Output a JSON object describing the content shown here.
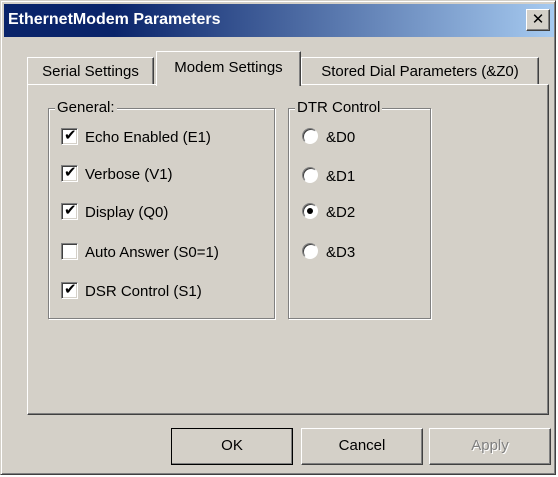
{
  "window": {
    "title": "EthernetModem Parameters",
    "close_glyph": "✕"
  },
  "tabs": [
    {
      "label": "Serial Settings",
      "active": false
    },
    {
      "label": "Modem Settings",
      "active": true
    },
    {
      "label": "Stored Dial Parameters (&Z0)",
      "active": false
    }
  ],
  "general": {
    "title": "General:",
    "options": [
      {
        "label": "Echo Enabled (E1)",
        "checked": true
      },
      {
        "label": "Verbose (V1)",
        "checked": true
      },
      {
        "label": "Display (Q0)",
        "checked": true
      },
      {
        "label": "Auto Answer (S0=1)",
        "checked": false
      },
      {
        "label": "DSR Control (S1)",
        "checked": true
      }
    ]
  },
  "dtr": {
    "title": "DTR Control",
    "options": [
      {
        "label": "&D0",
        "selected": false
      },
      {
        "label": "&D1",
        "selected": false
      },
      {
        "label": "&D2",
        "selected": true
      },
      {
        "label": "&D3",
        "selected": false
      }
    ]
  },
  "buttons": {
    "ok": "OK",
    "cancel": "Cancel",
    "apply": "Apply"
  },
  "colors": {
    "titlebar_start": "#0a246a",
    "titlebar_end": "#a6caf0",
    "face": "#d4d0c8"
  }
}
